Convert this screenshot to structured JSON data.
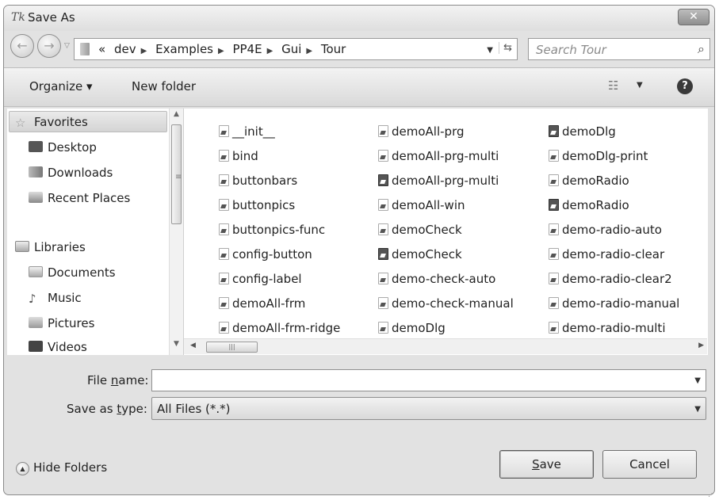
{
  "window": {
    "title": "Save As",
    "app_icon": "Tk",
    "close_label": "✕"
  },
  "nav": {
    "back_icon": "arrow-left",
    "forward_icon": "arrow-right",
    "path_prefix": "«",
    "path": [
      "dev",
      "Examples",
      "PP4E",
      "Gui",
      "Tour"
    ],
    "search_placeholder": "Search Tour"
  },
  "toolbar": {
    "organize": "Organize ▾",
    "new_folder": "New folder",
    "views_icon": "views-list",
    "help": "?"
  },
  "sidebar": {
    "favorites": {
      "label": "Favorites",
      "items": [
        "Desktop",
        "Downloads",
        "Recent Places"
      ]
    },
    "libraries": {
      "label": "Libraries",
      "items": [
        "Documents",
        "Music",
        "Pictures",
        "Videos"
      ]
    }
  },
  "files": {
    "col1": [
      {
        "name": "__init__",
        "dark": false
      },
      {
        "name": "bind",
        "dark": false
      },
      {
        "name": "buttonbars",
        "dark": false
      },
      {
        "name": "buttonpics",
        "dark": false
      },
      {
        "name": "buttonpics-func",
        "dark": false
      },
      {
        "name": "config-button",
        "dark": false
      },
      {
        "name": "config-label",
        "dark": false
      },
      {
        "name": "demoAll-frm",
        "dark": false
      },
      {
        "name": "demoAll-frm-ridge",
        "dark": false
      }
    ],
    "col2": [
      {
        "name": "demoAll-prg",
        "dark": false
      },
      {
        "name": "demoAll-prg-multi",
        "dark": false
      },
      {
        "name": "demoAll-prg-multi",
        "dark": true
      },
      {
        "name": "demoAll-win",
        "dark": false
      },
      {
        "name": "demoCheck",
        "dark": false
      },
      {
        "name": "demoCheck",
        "dark": true
      },
      {
        "name": "demo-check-auto",
        "dark": false
      },
      {
        "name": "demo-check-manual",
        "dark": false
      },
      {
        "name": "demoDlg",
        "dark": false
      }
    ],
    "col3": [
      {
        "name": "demoDlg",
        "dark": true
      },
      {
        "name": "demoDlg-print",
        "dark": false
      },
      {
        "name": "demoRadio",
        "dark": false
      },
      {
        "name": "demoRadio",
        "dark": true
      },
      {
        "name": "demo-radio-auto",
        "dark": false
      },
      {
        "name": "demo-radio-clear",
        "dark": false
      },
      {
        "name": "demo-radio-clear2",
        "dark": false
      },
      {
        "name": "demo-radio-manual",
        "dark": false
      },
      {
        "name": "demo-radio-multi",
        "dark": false
      }
    ]
  },
  "form": {
    "file_name_label_pre": "File ",
    "file_name_label_u": "n",
    "file_name_label_post": "ame:",
    "file_name_value": "",
    "save_type_label_pre": "Save as ",
    "save_type_label_u": "t",
    "save_type_label_post": "ype:",
    "save_type_value": "All Files (*.*)"
  },
  "footer": {
    "hide_folders": "Hide Folders",
    "save_u": "S",
    "save_rest": "ave",
    "cancel": "Cancel"
  }
}
